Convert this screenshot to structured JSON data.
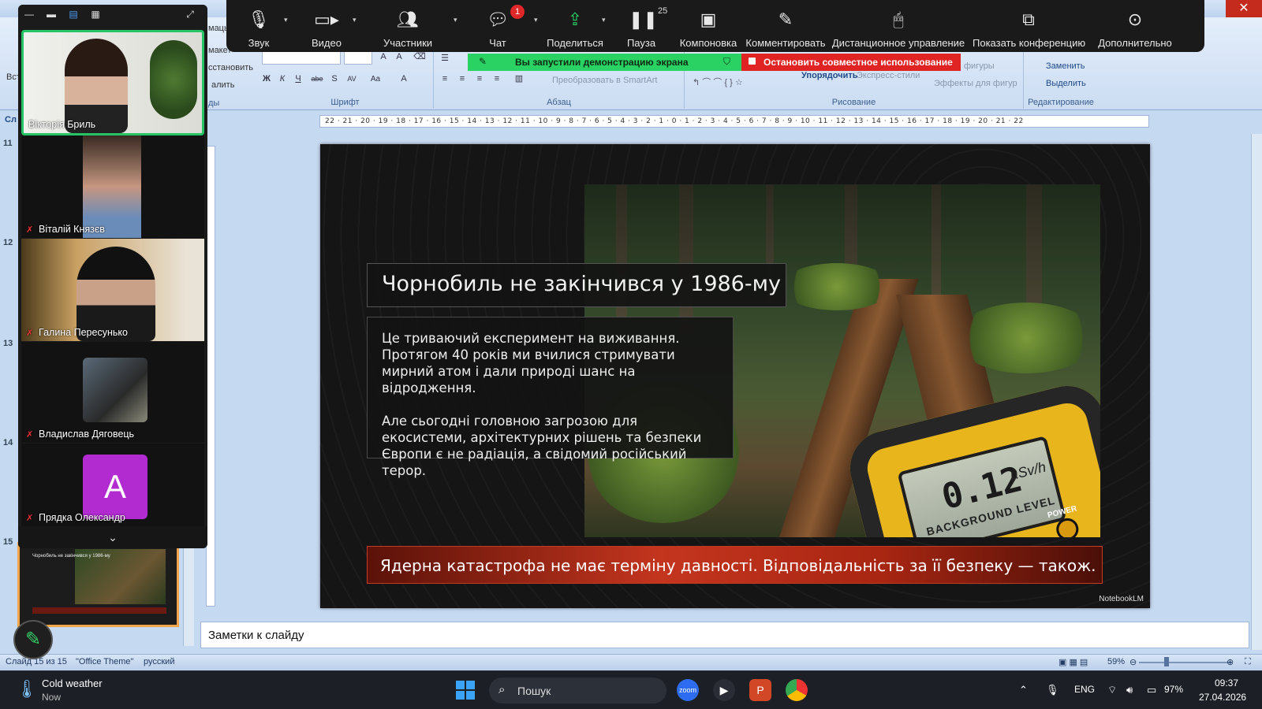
{
  "powerpoint": {
    "ribbon": {
      "group_font": "Шрифт",
      "group_paragraph": "Абзац",
      "group_drawing": "Рисование",
      "group_editing": "Редактирование",
      "cmd_restore": "сстановить",
      "cmd_delete": "алить",
      "cmd_layout_prefix": "макет",
      "cmd_smartart": "Преобразовать в SmartArt",
      "cmd_arrange": "Упорядочить",
      "cmd_quick_styles": "Экспресс-стили",
      "cmd_shapes": "фигуры",
      "cmd_shape_effects": "Эффекты для фигур",
      "cmd_replace": "Заменить",
      "cmd_select": "Выделить",
      "cmd_insert": "Вст",
      "cmd_frame": "мацы",
      "tab_slides": "Сл",
      "group_slides_tail": "ды"
    },
    "ruler_text": "22 · 21 · 20 · 19 · 18 · 17 · 16 · 15 · 14 · 13 · 12 · 11 · 10 · 9 · 8 · 7 · 6 · 5 · 4 · 3 · 2 · 1 · 0 · 1 · 2 · 3 · 4 · 5 · 6 · 7 · 8 · 9 · 10 · 11 · 12 · 13 · 14 · 15 · 16 · 17 · 18 · 19 · 20 · 21 · 22",
    "slide_numbers": [
      "11",
      "12",
      "13",
      "14",
      "15"
    ],
    "slide": {
      "title": "Чорнобиль не закінчився у 1986-му",
      "paragraph_1": "Це триваючий експеримент на виживання. Протягом 40 років ми вчилися стримувати мирний атом і дали природі шанс на відродження.",
      "paragraph_2": "Але сьогодні головною загрозою для екосистеми, архітектурних рішень та безпеки Європи є не радіація, а свідомий російський терор.",
      "banner": "Ядерна катастрофа не має терміну давності. Відповідальність за її безпеку — також.",
      "watermark": "NotebookLM",
      "meter_value": "0.12",
      "meter_unit": "µSv/h",
      "meter_label": "BACKGROUND LEVEL",
      "meter_power": "POWER"
    },
    "thumb_title": "Чорнобиль не закінчився у 1986-му",
    "notes_placeholder": "Заметки к слайду",
    "status": {
      "slide_counter": "Слайд 15 из 15",
      "theme": "\"Office Theme\"",
      "language": "русский",
      "zoom": "59%"
    }
  },
  "zoom": {
    "toolbar": [
      {
        "id": "audio",
        "label": "Звук",
        "icon": "microphone-icon"
      },
      {
        "id": "video",
        "label": "Видео",
        "icon": "video-camera-icon"
      },
      {
        "id": "participants",
        "label": "Участники",
        "icon": "participants-icon",
        "count": "25"
      },
      {
        "id": "chat",
        "label": "Чат",
        "icon": "chat-icon",
        "badge": "1"
      },
      {
        "id": "share",
        "label": "Поделиться",
        "icon": "share-screen-icon"
      },
      {
        "id": "pause",
        "label": "Пауза",
        "icon": "pause-icon"
      },
      {
        "id": "layout",
        "label": "Компоновка",
        "icon": "layout-icon"
      },
      {
        "id": "annotate",
        "label": "Комментировать",
        "icon": "pencil-icon"
      },
      {
        "id": "remote",
        "label": "Дистанционное управление",
        "icon": "mouse-icon"
      },
      {
        "id": "show_conf",
        "label": "Показать конференцию",
        "icon": "show-meeting-icon"
      },
      {
        "id": "more",
        "label": "Дополнительно",
        "icon": "more-icon"
      }
    ],
    "share_banner": "Вы запустили демонстрацию экрана",
    "stop_banner": "Остановить совместное использование",
    "participants": [
      {
        "name": "Вікторія Бриль",
        "muted": false
      },
      {
        "name": "Віталій Князєв",
        "muted": true
      },
      {
        "name": "Галина Пересунько",
        "muted": true
      },
      {
        "name": "Владислав Дяговець",
        "muted": true
      },
      {
        "name": "Прядка Олександр",
        "muted": true,
        "avatar_letter": "A"
      }
    ],
    "accent_colors": {
      "share_green": "#2ad163",
      "stop_red": "#e02424",
      "active_speaker": "#27c466",
      "avatar_purple": "#b12bd1"
    }
  },
  "taskbar": {
    "weather_title": "Cold weather",
    "weather_sub": "Now",
    "search_placeholder": "Пошук",
    "language": "ENG",
    "battery": "97%",
    "time": "09:37",
    "date": "27.04.2026"
  }
}
